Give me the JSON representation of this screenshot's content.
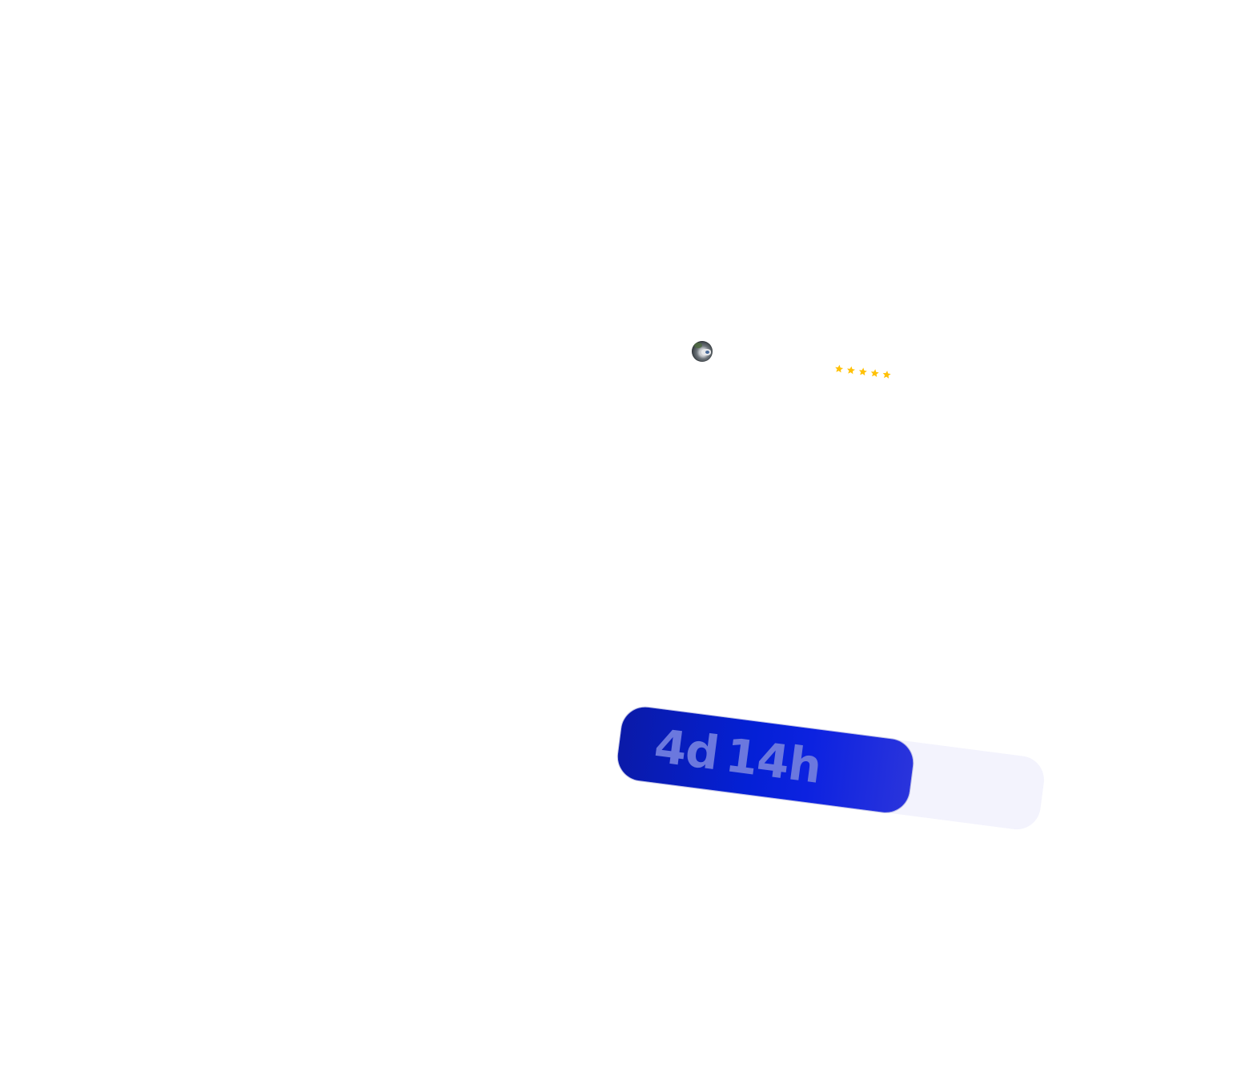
{
  "countdown": {
    "days": "4d",
    "hours": "14h",
    "progress_percent": 69,
    "fill_color": "#0420d6",
    "track_color": "#f3f3fd",
    "label_color": "#6b78de"
  },
  "rating": {
    "value": 5,
    "max": 5,
    "star_color": "#ffc107",
    "icon": "star-icon"
  },
  "avatar": {
    "icon": "avatar-photo"
  }
}
